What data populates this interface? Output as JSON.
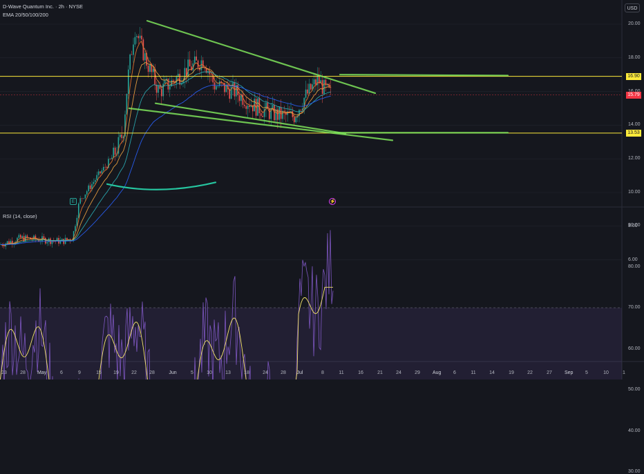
{
  "header": {
    "symbol_line": "D-Wave Quantum Inc. · 2h · NYSE",
    "indicator_line": "EMA 20/50/100/200"
  },
  "toolbar": {
    "currency_label": "USD"
  },
  "price_axis": {
    "labels": [
      "20.00",
      "18.00",
      "16.00",
      "14.00",
      "12.00",
      "10.00",
      "8.00",
      "6.00"
    ]
  },
  "price_tags": [
    {
      "label": "16.90",
      "bg": "#ffeb3b",
      "fg": "#131722"
    },
    {
      "label": "15.79",
      "bg": "#f23645",
      "fg": "#ffffff"
    },
    {
      "label": "13.53",
      "bg": "#ffeb3b",
      "fg": "#131722"
    }
  ],
  "rsi": {
    "title": "RSI (14, close)",
    "axis_labels": [
      "90.00",
      "80.00",
      "70.00",
      "60.00",
      "50.00",
      "40.00",
      "30.00"
    ]
  },
  "time_axis": {
    "labels": [
      "23",
      "28",
      "May",
      "6",
      "9",
      "15",
      "19",
      "22",
      "28",
      "Jun",
      "5",
      "10",
      "13",
      "18",
      "24",
      "28",
      "Jul",
      "8",
      "11",
      "16",
      "21",
      "24",
      "29",
      "Aug",
      "6",
      "11",
      "14",
      "19",
      "22",
      "27",
      "Sep",
      "5",
      "10",
      "1"
    ]
  },
  "events": [
    {
      "name": "earnings-icon",
      "glyph": "E"
    },
    {
      "name": "lightning-icon",
      "glyph": "⚡"
    }
  ],
  "colors": {
    "background": "#15171e",
    "up_candle": "#26a69a",
    "down_candle": "#ef5350",
    "trendline": "#7ee35a",
    "horizontal_level": "#ffeb3b",
    "rsi_line": "#7e57c2",
    "rsi_ma": "#f5e56b"
  }
}
